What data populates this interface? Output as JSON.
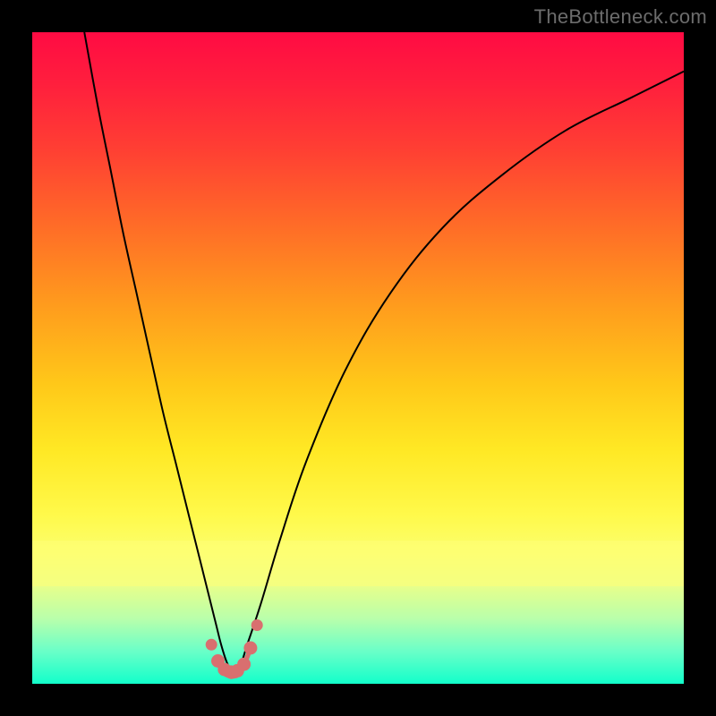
{
  "watermark": "TheBottleneck.com",
  "colors": {
    "background": "#000000",
    "curve": "#000000",
    "points": "#d96f6f"
  },
  "chart_data": {
    "type": "line",
    "title": "",
    "xlabel": "",
    "ylabel": "",
    "xlim": [
      0,
      100
    ],
    "ylim": [
      0,
      100
    ],
    "grid": false,
    "legend": false,
    "annotations": [
      "TheBottleneck.com"
    ],
    "series": [
      {
        "name": "curve",
        "x": [
          8,
          10,
          12,
          14,
          16,
          18,
          20,
          22,
          24,
          26,
          28,
          29,
          30,
          31,
          32,
          33,
          35,
          38,
          42,
          48,
          55,
          63,
          72,
          82,
          92,
          100
        ],
        "y": [
          100,
          89,
          79,
          69,
          60,
          51,
          42,
          34,
          26,
          18,
          10,
          6,
          3,
          2,
          3,
          6,
          12,
          22,
          34,
          48,
          60,
          70,
          78,
          85,
          90,
          94
        ]
      }
    ],
    "points": [
      {
        "x": 27.5,
        "y": 6.0
      },
      {
        "x": 28.5,
        "y": 3.5
      },
      {
        "x": 29.5,
        "y": 2.2
      },
      {
        "x": 30.5,
        "y": 1.8
      },
      {
        "x": 31.5,
        "y": 2.0
      },
      {
        "x": 32.5,
        "y": 3.0
      },
      {
        "x": 33.5,
        "y": 5.5
      },
      {
        "x": 34.5,
        "y": 9.0
      }
    ]
  }
}
